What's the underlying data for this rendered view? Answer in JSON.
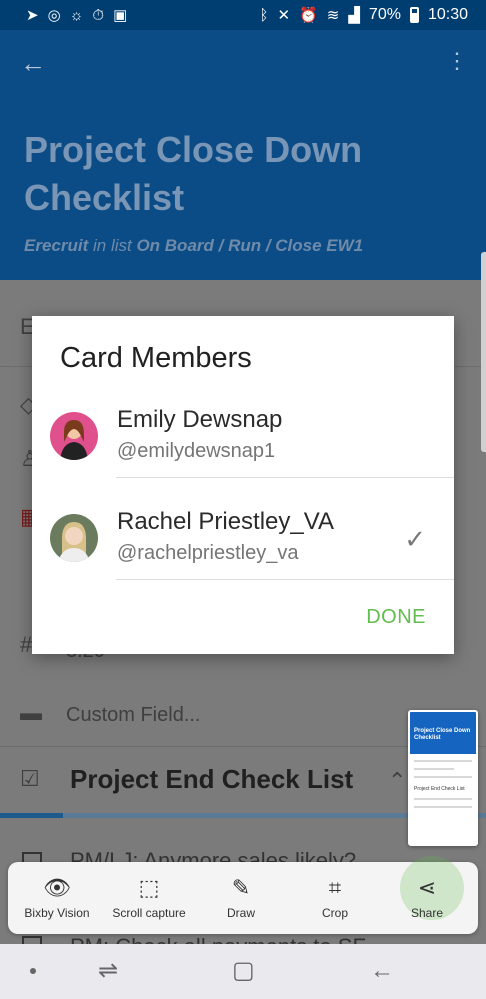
{
  "status_bar": {
    "battery_percent": "70%",
    "time": "10:30",
    "left_icons": [
      "navigation-icon",
      "nfc-icon",
      "weather-icon",
      "timer-icon",
      "image-icon"
    ],
    "right_icons": [
      "bluetooth-icon",
      "mute-icon",
      "alarm-icon",
      "wifi-icon",
      "signal-icon",
      "battery-icon"
    ]
  },
  "header": {
    "title": "Project Close Down Checklist",
    "board": "Erecruit",
    "in_list_text": "in list",
    "list_path": "On Board / Run / Close EW1"
  },
  "body": {
    "due_value": "3.20",
    "custom_fields_label": "Custom Field...",
    "checklist_title": "Project End Check List",
    "items": [
      "PM/LJ: Anymore sales likely? Update SF",
      "PM: Check all payments to SF"
    ]
  },
  "dialog": {
    "title": "Card Members",
    "members": [
      {
        "name": "Emily Dewsnap",
        "handle": "@emilydewsnap1",
        "selected": false
      },
      {
        "name": "Rachel Priestley_VA",
        "handle": "@rachelpriestley_va",
        "selected": true
      }
    ],
    "done_label": "DONE"
  },
  "thumbnail": {
    "title": "Project Close Down Checklist",
    "checklist": "Project End Check List"
  },
  "toolbar": {
    "tools": [
      {
        "label": "Bixby Vision",
        "icon": "eye-icon"
      },
      {
        "label": "Scroll capture",
        "icon": "scroll-capture-icon"
      },
      {
        "label": "Draw",
        "icon": "pen-icon"
      },
      {
        "label": "Crop",
        "icon": "crop-icon"
      },
      {
        "label": "Share",
        "icon": "share-icon"
      }
    ]
  },
  "colors": {
    "header_bg": "#0b4c86",
    "status_bar_bg": "#003e72",
    "accent_green": "#61bd4f",
    "overlay_grey": "#7b7b7b"
  }
}
